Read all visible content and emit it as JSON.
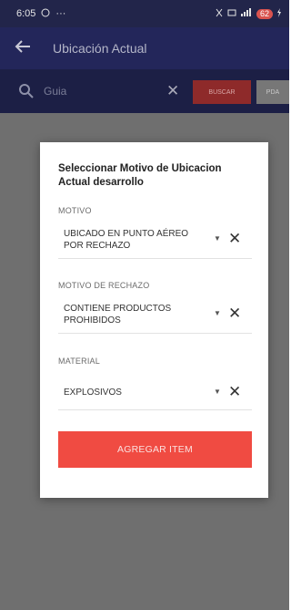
{
  "status_bar": {
    "time": "6:05",
    "whatsapp_icon": "whatsapp-icon",
    "more": "···",
    "battery": "62"
  },
  "app_bar": {
    "title": "Ubicación Actual"
  },
  "search": {
    "placeholder": "Guia",
    "buscar_label": "BUSCAR",
    "pda_label": "PDA"
  },
  "dialog": {
    "title": "Seleccionar Motivo de Ubicacion Actual desarrollo",
    "motivo": {
      "label": "MOTIVO",
      "value": "UBICADO EN PUNTO AÉREO POR RECHAZO"
    },
    "motivo_rechazo": {
      "label": "MOTIVO DE RECHAZO",
      "value": "CONTIENE PRODUCTOS PROHIBIDOS"
    },
    "material": {
      "label": "MATERIAL",
      "value": "EXPLOSIVOS"
    },
    "add_button_label": "AGREGAR ITEM"
  },
  "colors": {
    "appbar": "#23265a",
    "overlay": "#6f6f6f",
    "accent_red": "#f04b42"
  }
}
